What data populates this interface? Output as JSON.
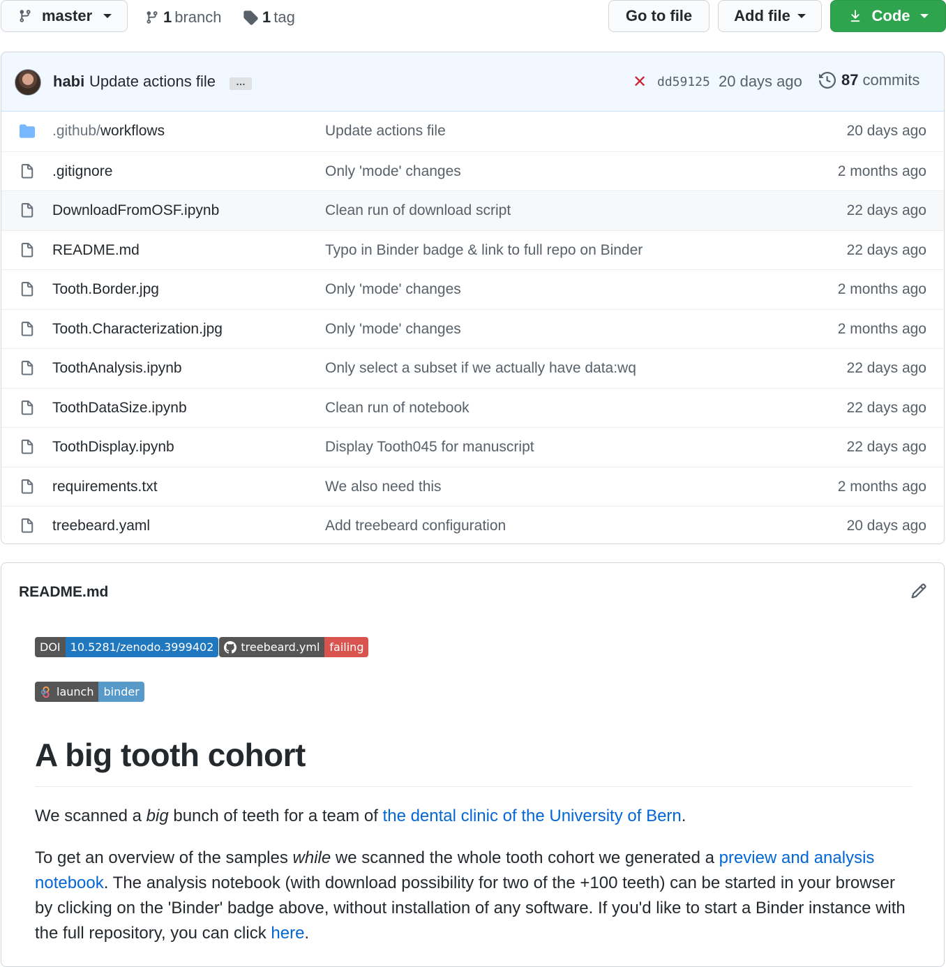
{
  "toolbar": {
    "branch_button": "master",
    "branches_count": "1",
    "branches_label": "branch",
    "tags_count": "1",
    "tags_label": "tag",
    "go_to_file": "Go to file",
    "add_file": "Add file",
    "code": "Code"
  },
  "latest_commit": {
    "author": "habi",
    "message": "Update actions file",
    "ellipsis": "…",
    "status": "✕",
    "sha": "dd59125",
    "age": "20 days ago",
    "commits_count": "87",
    "commits_label": "commits"
  },
  "files": [
    {
      "prefix": ".github/",
      "name": "workflows",
      "message": "Update actions file",
      "age": "20 days ago",
      "type": "folder"
    },
    {
      "prefix": "",
      "name": ".gitignore",
      "message": "Only 'mode' changes",
      "age": "2 months ago",
      "type": "file"
    },
    {
      "prefix": "",
      "name": "DownloadFromOSF.ipynb",
      "message": "Clean run of download script",
      "age": "22 days ago",
      "type": "file"
    },
    {
      "prefix": "",
      "name": "README.md",
      "message": "Typo in Binder badge & link to full repo on Binder",
      "age": "22 days ago",
      "type": "file"
    },
    {
      "prefix": "",
      "name": "Tooth.Border.jpg",
      "message": "Only 'mode' changes",
      "age": "2 months ago",
      "type": "file"
    },
    {
      "prefix": "",
      "name": "Tooth.Characterization.jpg",
      "message": "Only 'mode' changes",
      "age": "2 months ago",
      "type": "file"
    },
    {
      "prefix": "",
      "name": "ToothAnalysis.ipynb",
      "message": "Only select a subset if we actually have data:wq",
      "age": "22 days ago",
      "type": "file"
    },
    {
      "prefix": "",
      "name": "ToothDataSize.ipynb",
      "message": "Clean run of notebook",
      "age": "22 days ago",
      "type": "file"
    },
    {
      "prefix": "",
      "name": "ToothDisplay.ipynb",
      "message": "Display Tooth045 for manuscript",
      "age": "22 days ago",
      "type": "file"
    },
    {
      "prefix": "",
      "name": "requirements.txt",
      "message": "We also need this",
      "age": "2 months ago",
      "type": "file"
    },
    {
      "prefix": "",
      "name": "treebeard.yaml",
      "message": "Add treebeard configuration",
      "age": "20 days ago",
      "type": "file"
    }
  ],
  "readme": {
    "title": "README.md",
    "badges": {
      "doi_label": "DOI",
      "doi_value": "10.5281/zenodo.3999402",
      "workflow_label": "treebeard.yml",
      "workflow_status": "failing",
      "binder_label": "launch",
      "binder_value": "binder"
    },
    "heading": "A big tooth cohort",
    "p1_a": "We scanned a ",
    "p1_em": "big",
    "p1_b": " bunch of teeth for a team of ",
    "p1_link": "the dental clinic of the University of Bern",
    "p1_c": ".",
    "p2_a": "To get an overview of the samples ",
    "p2_em": "while",
    "p2_b": " we scanned the whole tooth cohort we generated a ",
    "p2_link": "preview and analysis notebook",
    "p2_c": ". The analysis notebook (with download possibility for two of the +100 teeth) can be started in your browser by clicking on the 'Binder' badge above, without installation of any software. If you'd like to start a Binder instance with the full repository, you can click ",
    "p2_link2": "here",
    "p2_d": "."
  },
  "colors": {
    "code_button": "#2ea44f",
    "link": "#0366d6",
    "commit_bar": "#f1f8ff",
    "fail": "#cb2431"
  }
}
